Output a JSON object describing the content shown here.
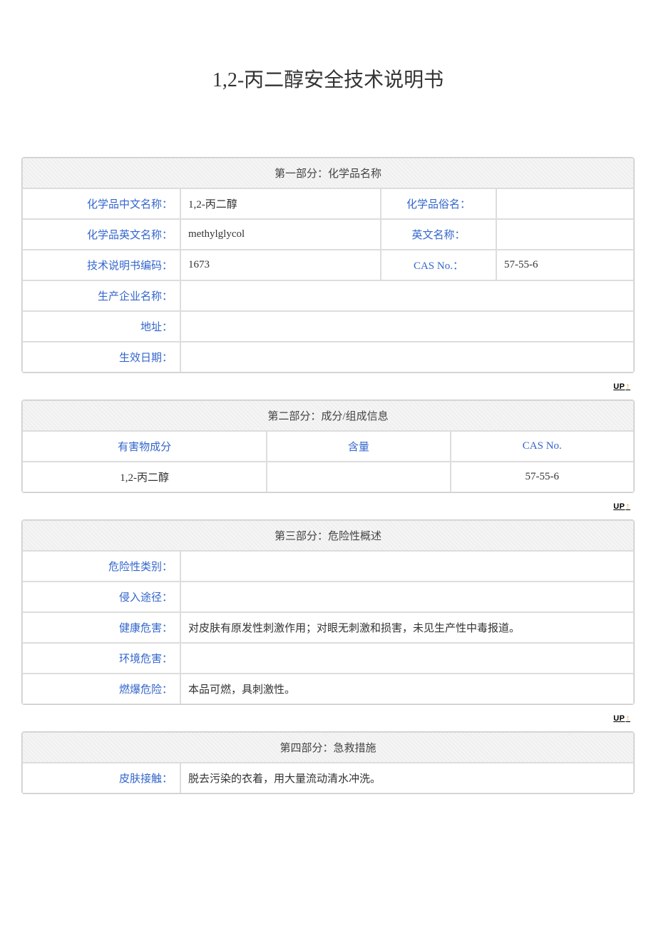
{
  "title": "1,2-丙二醇安全技术说明书",
  "up_label": "UP",
  "section1": {
    "header": "第一部分：化学品名称",
    "rows": {
      "cn_name_label": "化学品中文名称：",
      "cn_name_value": "1,2-丙二醇",
      "common_name_label": "化学品俗名：",
      "common_name_value": "",
      "en_name_label": "化学品英文名称：",
      "en_name_value": "methylglycol",
      "en_label": "英文名称：",
      "en_value": "",
      "code_label": "技术说明书编码：",
      "code_value": "1673",
      "cas_label": "CAS No.：",
      "cas_value": "57-55-6",
      "manufacturer_label": "生产企业名称：",
      "manufacturer_value": "",
      "address_label": "地址：",
      "address_value": "",
      "effective_label": "生效日期：",
      "effective_value": ""
    }
  },
  "section2": {
    "header": "第二部分：成分/组成信息",
    "col1": "有害物成分",
    "col2": "含量",
    "col3": "CAS No.",
    "row1": {
      "c1": "1,2-丙二醇",
      "c2": "",
      "c3": "57-55-6"
    }
  },
  "section3": {
    "header": "第三部分：危险性概述",
    "hazard_class_label": "危险性类别：",
    "hazard_class_value": "",
    "route_label": "侵入途径：",
    "route_value": "",
    "health_label": "健康危害：",
    "health_value": "对皮肤有原发性刺激作用；对眼无刺激和损害，未见生产性中毒报道。",
    "env_label": "环境危害：",
    "env_value": "",
    "fire_label": "燃爆危险：",
    "fire_value": "本品可燃，具刺激性。"
  },
  "section4": {
    "header": "第四部分：急救措施",
    "skin_label": "皮肤接触：",
    "skin_value": "脱去污染的衣着，用大量流动清水冲洗。"
  }
}
